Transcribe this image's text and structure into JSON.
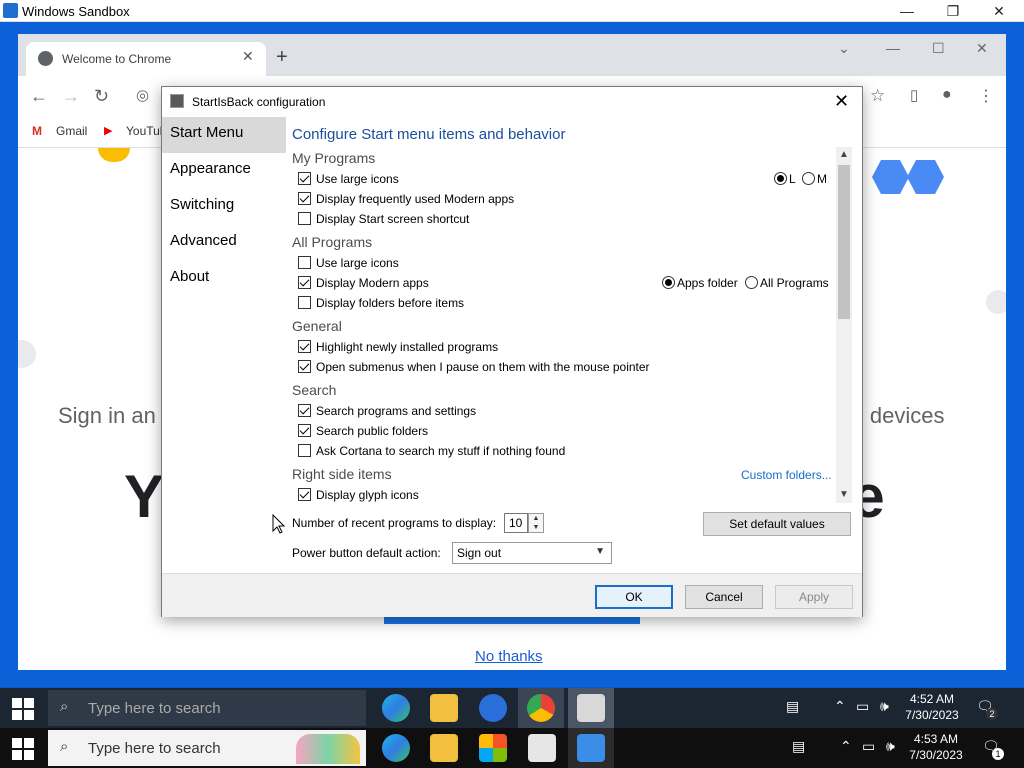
{
  "sandbox": {
    "title": "Windows Sandbox",
    "min": "—",
    "max": "❐",
    "close": "✕"
  },
  "chrome": {
    "tab_title": "Welcome to Chrome",
    "new_tab": "+",
    "bookmarks": [
      "Gmail",
      "YouTube"
    ],
    "bg_signin": "Sign in an",
    "bg_devices": "ll devices",
    "bg_huge_left": "Y",
    "bg_huge_right": "re",
    "no_thanks": "No thanks"
  },
  "dialog": {
    "title": "StartIsBack configuration",
    "close": "✕",
    "nav": [
      "Start Menu",
      "Appearance",
      "Switching",
      "Advanced",
      "About"
    ],
    "active_nav": 0,
    "heading": "Configure Start menu items and behavior",
    "sections": {
      "my_programs": "My Programs",
      "all_programs": "All Programs",
      "general": "General",
      "search": "Search",
      "right_side": "Right side items"
    },
    "options": {
      "mp_large_icons": {
        "label": "Use large icons",
        "checked": true
      },
      "mp_modern_apps": {
        "label": "Display frequently used Modern apps",
        "checked": true
      },
      "mp_start_shortcut": {
        "label": "Display Start screen shortcut",
        "checked": false
      },
      "ap_large_icons": {
        "label": "Use large icons",
        "checked": false
      },
      "ap_modern_apps": {
        "label": "Display Modern apps",
        "checked": true
      },
      "ap_folders_before": {
        "label": "Display folders before items",
        "checked": false
      },
      "gen_highlight": {
        "label": "Highlight newly installed programs",
        "checked": true
      },
      "gen_submenus": {
        "label": "Open submenus when I pause on them with the mouse pointer",
        "checked": true
      },
      "s_programs": {
        "label": "Search programs and settings",
        "checked": true
      },
      "s_public": {
        "label": "Search public folders",
        "checked": true
      },
      "s_cortana": {
        "label": "Ask Cortana to search my stuff if nothing found",
        "checked": false
      },
      "rs_glyph": {
        "label": "Display glyph icons",
        "checked": true
      }
    },
    "size_radio": {
      "l": "L",
      "m": "M",
      "selected": "L"
    },
    "apps_radio": {
      "apps_folder": "Apps folder",
      "all_programs": "All Programs",
      "selected": "Apps folder"
    },
    "custom_folders": "Custom folders...",
    "recent_label": "Number of recent programs to display:",
    "recent_value": "10",
    "power_label": "Power button default action:",
    "power_value": "Sign out",
    "set_default": "Set default values",
    "ok": "OK",
    "cancel": "Cancel",
    "apply": "Apply"
  },
  "taskbar_top": {
    "search_placeholder": "Type here to search",
    "time": "4:52 AM",
    "date": "7/30/2023",
    "badge": "2"
  },
  "taskbar_bottom": {
    "search_placeholder": "Type here to search",
    "time": "4:53 AM",
    "date": "7/30/2023",
    "badge": "1"
  },
  "colors": {
    "accent": "#1a73e8",
    "link": "#1a6ec9",
    "heading": "#1a4f9c"
  }
}
